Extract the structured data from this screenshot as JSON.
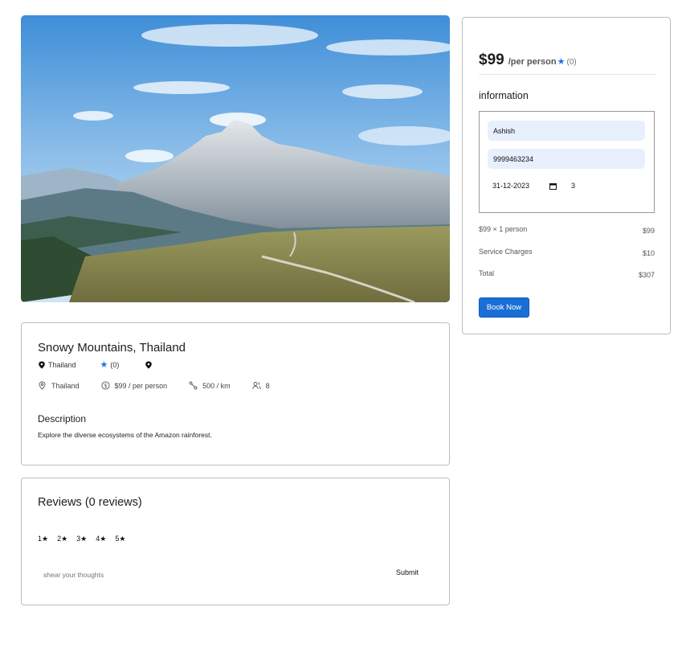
{
  "hero": {
    "alt": "Snowy Mountains"
  },
  "tour": {
    "title": "Snowy Mountains, Thailand",
    "city": "Thailand",
    "rating_count": "(0)",
    "address": "Thailand",
    "price_text": "$99 / per person",
    "distance_text": "500 / km",
    "group_size": "8",
    "description_heading": "Description",
    "description": "Explore the diverse ecosystems of the Amazon rainforest."
  },
  "reviews": {
    "heading": "Reviews (0 reviews)",
    "ratings": [
      "1★",
      "2★",
      "3★",
      "4★",
      "5★"
    ],
    "placeholder": "shear your thoughts",
    "submit_label": "Submit"
  },
  "booking": {
    "price": "$99",
    "per_label": "/per person",
    "rating_count": "(0)",
    "info_heading": "information",
    "name_value": "Ashish",
    "phone_value": "9999463234",
    "date_value": "31-12-2023",
    "guest_value": "3",
    "line_items": [
      {
        "label": "$99 × 1 person",
        "value": "$99"
      },
      {
        "label": "Service Charges",
        "value": "$10"
      },
      {
        "label": "Total",
        "value": "$307"
      }
    ],
    "book_label": "Book Now"
  },
  "colors": {
    "accent": "#1a73e8",
    "button": "#1a6fd6",
    "input_bg": "#e8f0fe"
  }
}
